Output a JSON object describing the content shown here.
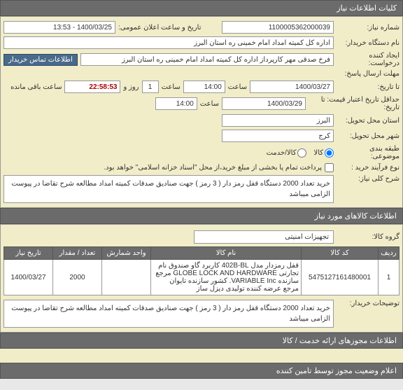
{
  "sections": {
    "header": "کلیات اطلاعات نیاز",
    "itemsHeader": "اطلاعات کالاهای مورد نیاز",
    "footerHeader": "اطلاعات مجوزهای ارائه خدمت / کالا",
    "statusHeader": "اعلام وضعیت مجوز توسط تامین کننده"
  },
  "labels": {
    "reqNo": "شماره نیاز:",
    "datePub": "تاریخ و ساعت اعلان عمومی:",
    "buyerOrg": "نام دستگاه خریدار:",
    "creator": "ایجاد کننده درخواست:",
    "contactBtn": "اطلاعات تماس خریدار",
    "replyDeadline": "مهلت ارسال پاسخ:",
    "untilDate": "تا تاریخ:",
    "saat": "ساعت",
    "rooz": "روز و",
    "remain": "ساعت باقی مانده",
    "minCred": "حداقل تاریخ اعتبار قیمت: تا تاریخ:",
    "deliveryProv": "استان محل تحویل:",
    "deliveryCity": "شهر محل تحویل:",
    "topicCls": "طبقه بندی موضوعی:",
    "goods": "کالا",
    "service": "کالا/خدمت",
    "procType": "نوع فرآیند خرید :",
    "procNote": "پرداخت تمام یا بخشی از مبلغ خرید،از محل \"اسناد خزانه اسلامی\" خواهد بود.",
    "mainDesc": "شرح کلی نیاز:",
    "goodsGroup": "گروه کالا:",
    "buyerNotes": "توضیحات خریدار:"
  },
  "values": {
    "reqNo": "1100005362000039",
    "datePub": "1400/03/25 - 13:53",
    "buyerOrg": "اداره کل کمیته امداد امام خمینی  ره  استان البرز",
    "creator": "فرخ  صدقی مهر کارپرداز اداره کل کمیته امداد امام خمینی  ره  استان البرز",
    "replyDate": "1400/03/27",
    "replyTime": "14:00",
    "counterDays": "1",
    "counterTime": "22:58:53",
    "credDate": "1400/03/29",
    "credTime": "14:00",
    "province": "البرز",
    "city": "کرج",
    "mainDesc": "خرید تعداد 2000 دستگاه قفل رمز دار ( 3 رمز ) جهت صنادیق صدقات کمیته امداد مطالعه شرح تقاضا در پیوست الزامی میباشد",
    "goodsGroup": "تجهیزات امنیتی",
    "buyerNotes": "خرید تعداد 2000 دستگاه قفل رمز دار ( 3 رمز ) جهت صنادیق صدقات کمیته امداد مطالعه شرح تقاضا در پیوست الزامی میباشد"
  },
  "table": {
    "headers": {
      "row": "ردیف",
      "code": "کد کالا",
      "name": "نام کالا",
      "unit": "واحد شمارش",
      "qty": "تعداد / مقدار",
      "date": "تاریخ نیاز"
    },
    "rows": [
      {
        "idx": "1",
        "code": "5475127161480001",
        "name": "قفل رمزدار مدل 402B-BL کاربرد گاو صندوق نام تجارتی GLOBE LOCK AND HARDWARE مرجع سازنده VARIABLE Inc. کشور سازنده تایوان مرجع عرضه کننده تولیدی دیزل ساز",
        "unit": "",
        "qty": "2000",
        "date": "1400/03/27"
      }
    ]
  }
}
